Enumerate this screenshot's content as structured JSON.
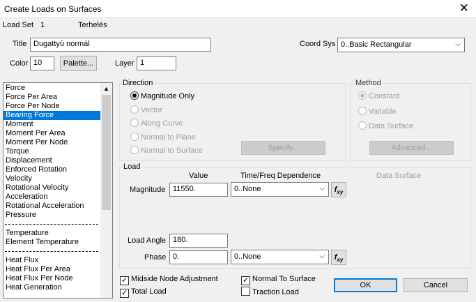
{
  "window": {
    "title": "Create Loads on Surfaces",
    "close_glyph": "✕"
  },
  "header": {
    "load_set_label": "Load Set",
    "load_set_value": "1",
    "load_set_name": "Terhelés",
    "title_label": "Title",
    "title_value": "Dugattyú normál",
    "coord_sys_label": "Coord Sys",
    "coord_sys_value": "0..Basic Rectangular",
    "color_label": "Color",
    "color_value": "10",
    "palette_label": "Palette...",
    "layer_label": "Layer",
    "layer_value": "1"
  },
  "load_types": {
    "items": [
      "Force",
      "Force Per Area",
      "Force Per Node",
      "Bearing Force",
      "Moment",
      "Moment Per Area",
      "Moment Per Node",
      "Torque",
      "Displacement",
      "Enforced Rotation",
      "Velocity",
      "Rotational Velocity",
      "Acceleration",
      "Rotational Acceleration",
      "Pressure"
    ],
    "selected_index": 3,
    "thermal_items": [
      "Temperature",
      "Element Temperature"
    ],
    "heat_items": [
      "Heat Flux",
      "Heat Flux Per Area",
      "Heat Flux Per Node",
      "Heat Generation"
    ]
  },
  "direction": {
    "label": "Direction",
    "options": [
      "Magnitude Only",
      "Vector",
      "Along Curve",
      "Normal to Plane",
      "Normal to Surface"
    ],
    "selected_index": 0,
    "specify_label": "Specify..."
  },
  "method": {
    "label": "Method",
    "options": [
      "Constant",
      "Variable",
      "Data Surface"
    ],
    "advanced_label": "Advanced..."
  },
  "load": {
    "label": "Load",
    "value_header": "Value",
    "time_header": "Time/Freq Dependence",
    "data_surface_header": "Data Surface",
    "magnitude_label": "Magnitude",
    "magnitude_value": "11550.",
    "magnitude_time": "0..None",
    "load_angle_label": "Load Angle",
    "load_angle_value": "180.",
    "phase_label": "Phase",
    "phase_value": "0.",
    "phase_time": "0..None",
    "fxy_label": "fxy"
  },
  "options": {
    "midside_label": "Midside Node Adjustment",
    "midside_checked": true,
    "total_load_label": "Total Load",
    "total_load_checked": true,
    "normal_surface_label": "Normal To Surface",
    "normal_surface_checked": true,
    "traction_label": "Traction Load",
    "traction_checked": false
  },
  "buttons": {
    "ok": "OK",
    "cancel": "Cancel"
  },
  "icons": {
    "combo_arrow": "chevron-down-icon",
    "scroll_up": "chevron-up-icon",
    "check": "check-icon"
  }
}
